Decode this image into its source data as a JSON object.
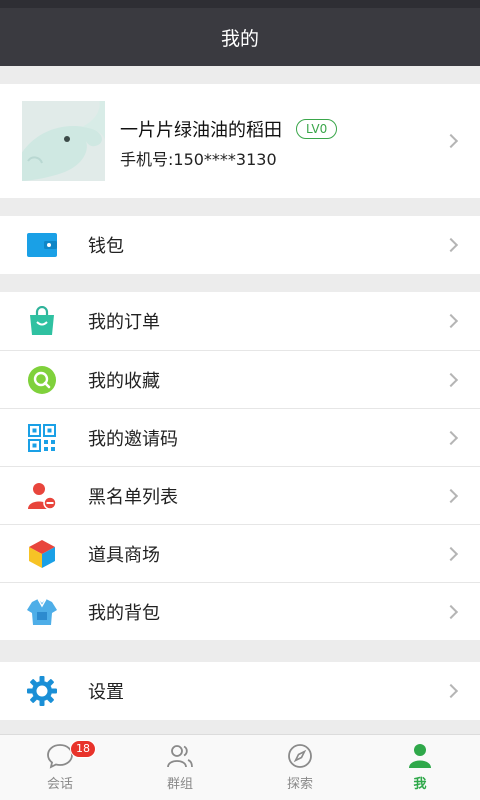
{
  "header": {
    "title": "我的"
  },
  "profile": {
    "name": "一片片绿油油的稻田",
    "level": "LV0",
    "phone": "手机号:150****3130"
  },
  "menu_groups": [
    [
      {
        "label": "钱包",
        "icon": "wallet-icon"
      }
    ],
    [
      {
        "label": "我的订单",
        "icon": "shopping-bag-icon"
      },
      {
        "label": "我的收藏",
        "icon": "favorites-icon"
      },
      {
        "label": "我的邀请码",
        "icon": "qr-code-icon"
      },
      {
        "label": "黑名单列表",
        "icon": "blocked-user-icon"
      },
      {
        "label": "道具商场",
        "icon": "cube-icon"
      },
      {
        "label": "我的背包",
        "icon": "backpack-icon"
      }
    ],
    [
      {
        "label": "设置",
        "icon": "gear-icon"
      }
    ]
  ],
  "tabs": [
    {
      "label": "会话",
      "icon": "chat-icon",
      "badge": "18",
      "active": false
    },
    {
      "label": "群组",
      "icon": "group-icon",
      "active": false
    },
    {
      "label": "探索",
      "icon": "compass-icon",
      "active": false
    },
    {
      "label": "我",
      "icon": "person-icon",
      "active": true
    }
  ],
  "colors": {
    "accent": "#2fa84a",
    "navbar": "#3a3a40",
    "badge": "#e8332b"
  }
}
